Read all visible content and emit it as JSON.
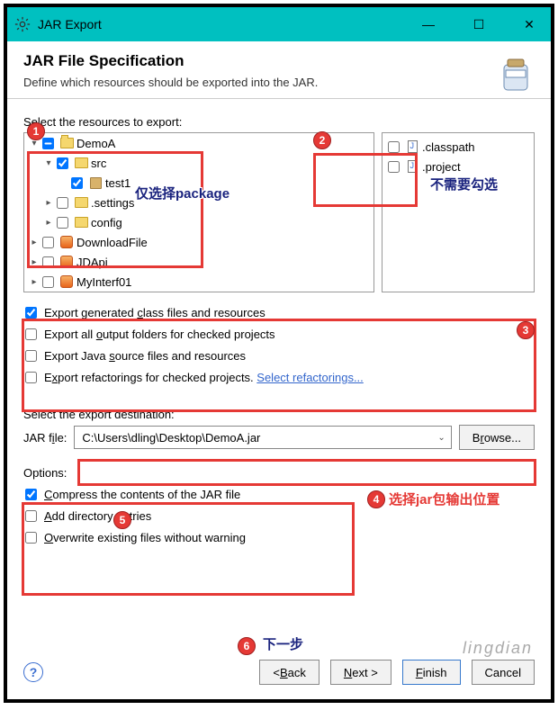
{
  "window": {
    "title": "JAR Export"
  },
  "header": {
    "title": "JAR File Specification",
    "subtitle": "Define which resources should be exported into the JAR."
  },
  "resources_label": "Select the resources to export:",
  "tree": {
    "items": [
      {
        "label": "DemoA",
        "level": 1,
        "expander": "▾",
        "checked": true,
        "indeterminate": true,
        "icon": "folder-open"
      },
      {
        "label": "src",
        "level": 2,
        "expander": "▾",
        "checked": true,
        "icon": "folder"
      },
      {
        "label": "test1",
        "level": 3,
        "expander": "",
        "checked": true,
        "icon": "package"
      },
      {
        "label": ".settings",
        "level": 2,
        "expander": "▸",
        "checked": false,
        "icon": "folder"
      },
      {
        "label": "config",
        "level": 2,
        "expander": "▸",
        "checked": false,
        "icon": "folder"
      },
      {
        "label": "DownloadFile",
        "level": 1,
        "expander": "▸",
        "checked": false,
        "icon": "plugin"
      },
      {
        "label": "JDApi",
        "level": 1,
        "expander": "▸",
        "checked": false,
        "icon": "plugin"
      },
      {
        "label": "MyInterf01",
        "level": 1,
        "expander": "▸",
        "checked": false,
        "icon": "plugin"
      }
    ]
  },
  "right_files": {
    "items": [
      {
        "label": ".classpath",
        "checked": false
      },
      {
        "label": ".project",
        "checked": false
      }
    ]
  },
  "export_checks": {
    "items": [
      {
        "label": "Export generated class files and resources",
        "checked": true,
        "u": "c"
      },
      {
        "label": "Export all output folders for checked projects",
        "checked": false,
        "u": "o"
      },
      {
        "label": "Export Java source files and resources",
        "checked": false,
        "u": "s"
      },
      {
        "label": "Export refactorings for checked projects.",
        "checked": false,
        "u": "x",
        "link": "Select refactorings..."
      }
    ]
  },
  "destination": {
    "label": "Select the export destination:",
    "field_label": "JAR file:",
    "value": "C:\\Users\\dling\\Desktop\\DemoA.jar",
    "browse": "Browse..."
  },
  "options": {
    "label": "Options:",
    "items": [
      {
        "label": "Compress the contents of the JAR file",
        "checked": true,
        "u": "C"
      },
      {
        "label": "Add directory entries",
        "checked": false,
        "u": "A"
      },
      {
        "label": "Overwrite existing files without warning",
        "checked": false,
        "u": "O"
      }
    ]
  },
  "buttons": {
    "back": "< Back",
    "next": "Next >",
    "finish": "Finish",
    "cancel": "Cancel"
  },
  "annotations": {
    "only_package": "仅选择package",
    "no_check": "不需要勾选",
    "output_pos": "选择jar包输出位置",
    "next_step": "下一步"
  },
  "watermark": "lingdian"
}
